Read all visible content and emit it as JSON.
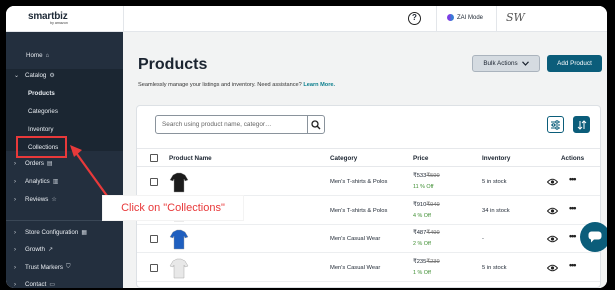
{
  "header": {
    "logo": "smartbiz",
    "logo_sub": "by amazon",
    "help_icon": "question-circle-icon",
    "mode_label": "ZAI Mode",
    "avatar_initials": "SW"
  },
  "sidebar": {
    "items": [
      {
        "label": "Home",
        "icon": "home-icon"
      },
      {
        "label": "Catalog",
        "icon": "gear-icon",
        "expanded": true
      },
      {
        "label": "Products",
        "sub": true,
        "selected": true
      },
      {
        "label": "Categories",
        "sub": true
      },
      {
        "label": "Inventory",
        "sub": true
      },
      {
        "label": "Collections",
        "sub": true
      },
      {
        "label": "Orders",
        "icon": "clipboard-icon"
      },
      {
        "label": "Analytics",
        "icon": "chart-icon"
      },
      {
        "label": "Reviews",
        "icon": "star-icon"
      },
      {
        "label": "Store Configuration",
        "icon": "store-icon"
      },
      {
        "label": "Growth",
        "icon": "trend-icon"
      },
      {
        "label": "Trust Markers",
        "icon": "shield-icon"
      },
      {
        "label": "Contact",
        "icon": "chat-icon"
      }
    ]
  },
  "main": {
    "title": "Products",
    "subtitle": "Seamlessly manage your listings and inventory. Need assistance?",
    "learn_more": "Learn More.",
    "bulk_actions": "Bulk Actions",
    "add_product": "Add Product",
    "search_placeholder": "Search using product name, categor…",
    "columns": [
      "Product Name",
      "Category",
      "Price",
      "Inventory",
      "Actions"
    ],
    "rows": [
      {
        "category": "Men's T-shirts & Polos",
        "price": "₹533",
        "old_price": "₹599",
        "off": "11 % Off",
        "inventory": "5 in stock",
        "thumb_color": "#1b1b1b"
      },
      {
        "category": "Men's T-shirts & Polos",
        "price": "₹910",
        "old_price": "₹949",
        "off": "4 % Off",
        "inventory": "34 in stock",
        "thumb_color": "#2b2b2b"
      },
      {
        "category": "Men's Casual Wear",
        "price": "₹487",
        "old_price": "₹499",
        "off": "2 % Off",
        "inventory": "-",
        "thumb_color": "#1f5fbf"
      },
      {
        "category": "Men's Casual Wear",
        "price": "₹235",
        "old_price": "₹239",
        "off": "1 % Off",
        "inventory": "5 in stock",
        "thumb_color": "#e8e8e8"
      }
    ]
  },
  "annotation": {
    "text": "Click on \"Collections\"",
    "color": "#e8393a"
  },
  "colors": {
    "sidebar_bg": "#232f3e",
    "primary": "#0b5d7a",
    "discount": "#3c8d2f",
    "annotation": "#e8393a"
  }
}
